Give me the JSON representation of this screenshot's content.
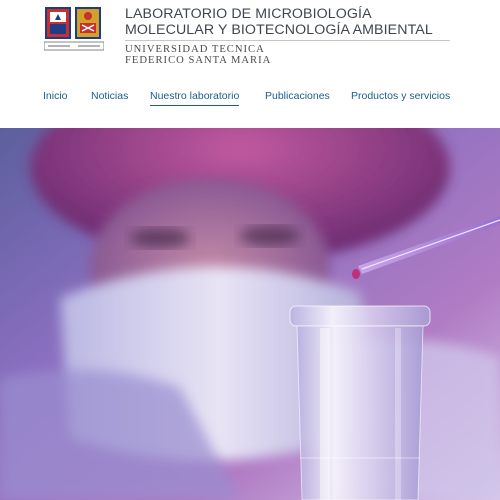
{
  "header": {
    "title_line1": "LABORATORIO DE MICROBIOLOGÍA",
    "title_line2": "MOLECULAR Y BIOTECNOLOGÍA AMBIENTAL",
    "university_line1": "UNIVERSIDAD TECNICA",
    "university_line2": "FEDERICO SANTA MARIA",
    "logo_icon": "university-crest-icon"
  },
  "nav": {
    "items": [
      {
        "label": "Inicio"
      },
      {
        "label": "Noticias"
      },
      {
        "label": "Nuestro laboratorio",
        "active": true
      },
      {
        "label": "Publicaciones"
      },
      {
        "label": "Productos y servicios"
      }
    ]
  },
  "hero": {
    "image_icon": "lab-scientist-pipette-image",
    "colors": {
      "violet": "#8a6fc0",
      "magenta": "#b05a9a",
      "white": "#f2eef6"
    }
  }
}
